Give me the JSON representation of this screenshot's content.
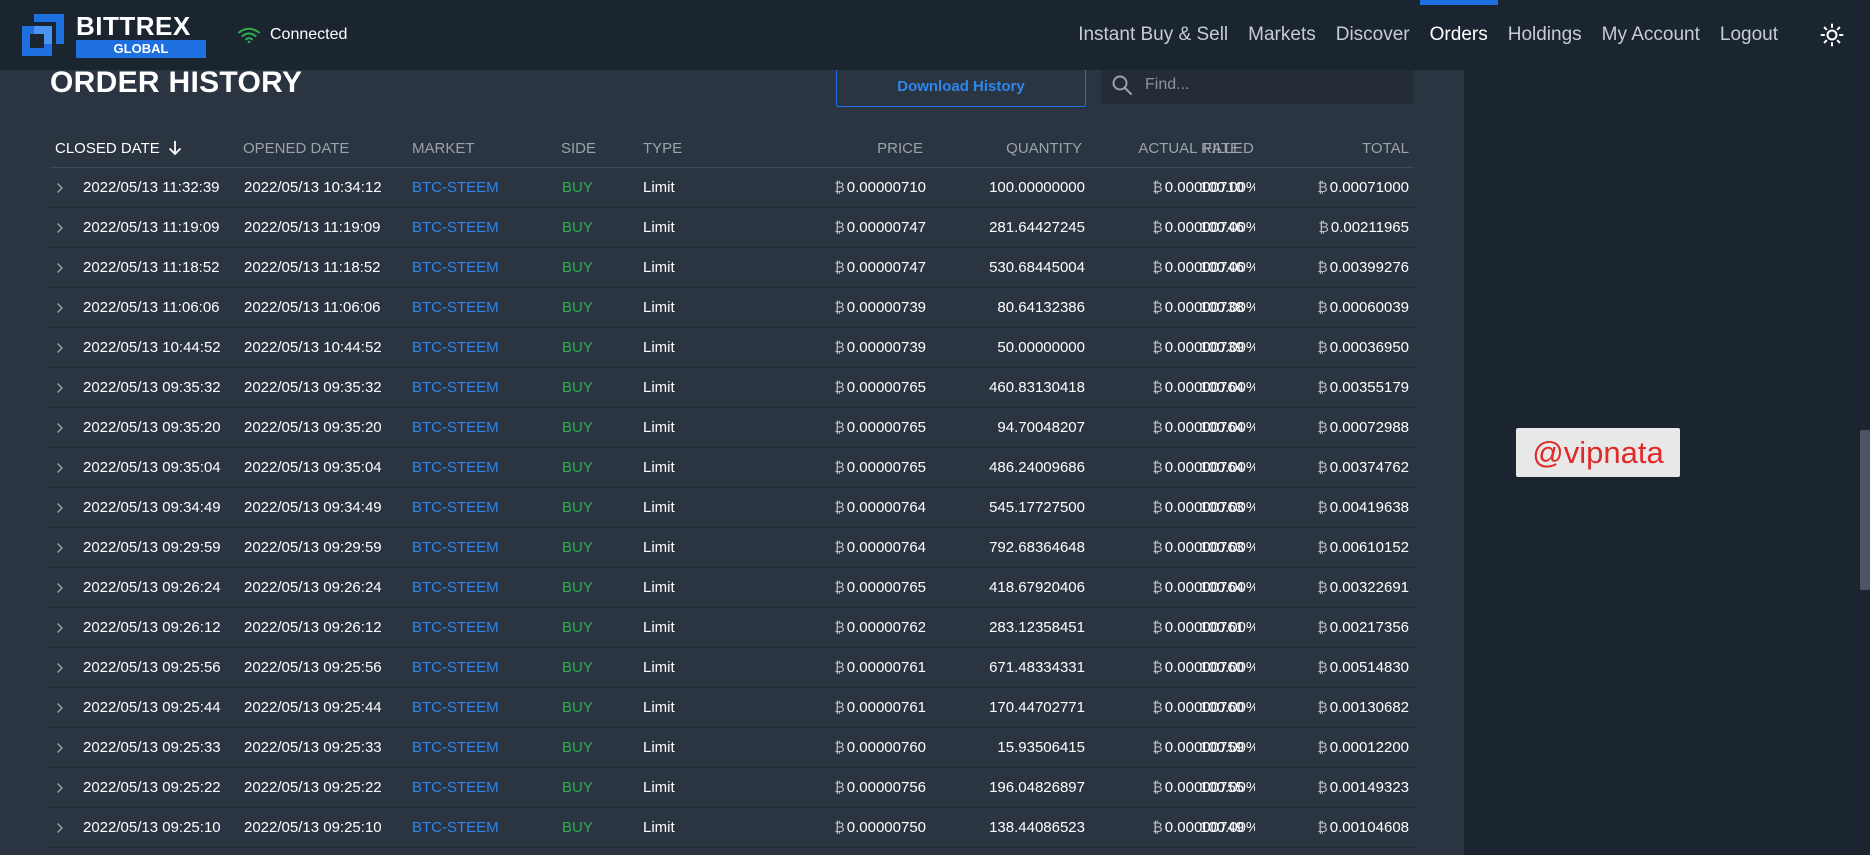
{
  "header": {
    "brand": "BITTREX",
    "brand_sub": "GLOBAL",
    "connection_status": "Connected",
    "nav": [
      "Instant Buy & Sell",
      "Markets",
      "Discover",
      "Orders",
      "Holdings",
      "My Account",
      "Logout"
    ],
    "active_nav": "Orders",
    "icons": {
      "logo": "bittrex-logo-icon",
      "connection": "wifi-icon",
      "theme": "sun-icon"
    }
  },
  "page": {
    "title": "ORDER HISTORY",
    "download_label": "Download History",
    "search_placeholder": "Find...",
    "watermark": "@vipnata"
  },
  "table": {
    "columns": [
      "CLOSED DATE",
      "OPENED DATE",
      "MARKET",
      "SIDE",
      "TYPE",
      "PRICE",
      "QUANTITY",
      "ACTUAL RATE",
      "FILLED",
      "TOTAL"
    ],
    "sorted_column": "CLOSED DATE",
    "sort_direction": "descending",
    "currency_symbol": "₿",
    "rows": [
      {
        "closed": "2022/05/13 11:32:39",
        "opened": "2022/05/13 10:34:12",
        "market": "BTC-STEEM",
        "side": "BUY",
        "type": "Limit",
        "price": "0.00000710",
        "quantity": "100.00000000",
        "rate": "0.00000710",
        "filled": "100.00%",
        "total": "0.00071000"
      },
      {
        "closed": "2022/05/13 11:19:09",
        "opened": "2022/05/13 11:19:09",
        "market": "BTC-STEEM",
        "side": "BUY",
        "type": "Limit",
        "price": "0.00000747",
        "quantity": "281.64427245",
        "rate": "0.00000746",
        "filled": "100.00%",
        "total": "0.00211965"
      },
      {
        "closed": "2022/05/13 11:18:52",
        "opened": "2022/05/13 11:18:52",
        "market": "BTC-STEEM",
        "side": "BUY",
        "type": "Limit",
        "price": "0.00000747",
        "quantity": "530.68445004",
        "rate": "0.00000746",
        "filled": "100.00%",
        "total": "0.00399276"
      },
      {
        "closed": "2022/05/13 11:06:06",
        "opened": "2022/05/13 11:06:06",
        "market": "BTC-STEEM",
        "side": "BUY",
        "type": "Limit",
        "price": "0.00000739",
        "quantity": "80.64132386",
        "rate": "0.00000738",
        "filled": "100.00%",
        "total": "0.00060039"
      },
      {
        "closed": "2022/05/13 10:44:52",
        "opened": "2022/05/13 10:44:52",
        "market": "BTC-STEEM",
        "side": "BUY",
        "type": "Limit",
        "price": "0.00000739",
        "quantity": "50.00000000",
        "rate": "0.00000739",
        "filled": "100.00%",
        "total": "0.00036950"
      },
      {
        "closed": "2022/05/13 09:35:32",
        "opened": "2022/05/13 09:35:32",
        "market": "BTC-STEEM",
        "side": "BUY",
        "type": "Limit",
        "price": "0.00000765",
        "quantity": "460.83130418",
        "rate": "0.00000764",
        "filled": "100.00%",
        "total": "0.00355179"
      },
      {
        "closed": "2022/05/13 09:35:20",
        "opened": "2022/05/13 09:35:20",
        "market": "BTC-STEEM",
        "side": "BUY",
        "type": "Limit",
        "price": "0.00000765",
        "quantity": "94.70048207",
        "rate": "0.00000764",
        "filled": "100.00%",
        "total": "0.00072988"
      },
      {
        "closed": "2022/05/13 09:35:04",
        "opened": "2022/05/13 09:35:04",
        "market": "BTC-STEEM",
        "side": "BUY",
        "type": "Limit",
        "price": "0.00000765",
        "quantity": "486.24009686",
        "rate": "0.00000764",
        "filled": "100.00%",
        "total": "0.00374762"
      },
      {
        "closed": "2022/05/13 09:34:49",
        "opened": "2022/05/13 09:34:49",
        "market": "BTC-STEEM",
        "side": "BUY",
        "type": "Limit",
        "price": "0.00000764",
        "quantity": "545.17727500",
        "rate": "0.00000763",
        "filled": "100.00%",
        "total": "0.00419638"
      },
      {
        "closed": "2022/05/13 09:29:59",
        "opened": "2022/05/13 09:29:59",
        "market": "BTC-STEEM",
        "side": "BUY",
        "type": "Limit",
        "price": "0.00000764",
        "quantity": "792.68364648",
        "rate": "0.00000763",
        "filled": "100.00%",
        "total": "0.00610152"
      },
      {
        "closed": "2022/05/13 09:26:24",
        "opened": "2022/05/13 09:26:24",
        "market": "BTC-STEEM",
        "side": "BUY",
        "type": "Limit",
        "price": "0.00000765",
        "quantity": "418.67920406",
        "rate": "0.00000764",
        "filled": "100.00%",
        "total": "0.00322691"
      },
      {
        "closed": "2022/05/13 09:26:12",
        "opened": "2022/05/13 09:26:12",
        "market": "BTC-STEEM",
        "side": "BUY",
        "type": "Limit",
        "price": "0.00000762",
        "quantity": "283.12358451",
        "rate": "0.00000761",
        "filled": "100.00%",
        "total": "0.00217356"
      },
      {
        "closed": "2022/05/13 09:25:56",
        "opened": "2022/05/13 09:25:56",
        "market": "BTC-STEEM",
        "side": "BUY",
        "type": "Limit",
        "price": "0.00000761",
        "quantity": "671.48334331",
        "rate": "0.00000760",
        "filled": "100.00%",
        "total": "0.00514830"
      },
      {
        "closed": "2022/05/13 09:25:44",
        "opened": "2022/05/13 09:25:44",
        "market": "BTC-STEEM",
        "side": "BUY",
        "type": "Limit",
        "price": "0.00000761",
        "quantity": "170.44702771",
        "rate": "0.00000760",
        "filled": "100.00%",
        "total": "0.00130682"
      },
      {
        "closed": "2022/05/13 09:25:33",
        "opened": "2022/05/13 09:25:33",
        "market": "BTC-STEEM",
        "side": "BUY",
        "type": "Limit",
        "price": "0.00000760",
        "quantity": "15.93506415",
        "rate": "0.00000759",
        "filled": "100.00%",
        "total": "0.00012200"
      },
      {
        "closed": "2022/05/13 09:25:22",
        "opened": "2022/05/13 09:25:22",
        "market": "BTC-STEEM",
        "side": "BUY",
        "type": "Limit",
        "price": "0.00000756",
        "quantity": "196.04826897",
        "rate": "0.00000755",
        "filled": "100.00%",
        "total": "0.00149323"
      },
      {
        "closed": "2022/05/13 09:25:10",
        "opened": "2022/05/13 09:25:10",
        "market": "BTC-STEEM",
        "side": "BUY",
        "type": "Limit",
        "price": "0.00000750",
        "quantity": "138.44086523",
        "rate": "0.00000749",
        "filled": "100.00%",
        "total": "0.00104608"
      }
    ]
  },
  "colors": {
    "background": "#2b3441",
    "header": "#1b2530",
    "accent": "#1e6fe0",
    "link": "#2e86ee",
    "buy": "#2eae4f",
    "watermark_text": "#e02a2a"
  }
}
